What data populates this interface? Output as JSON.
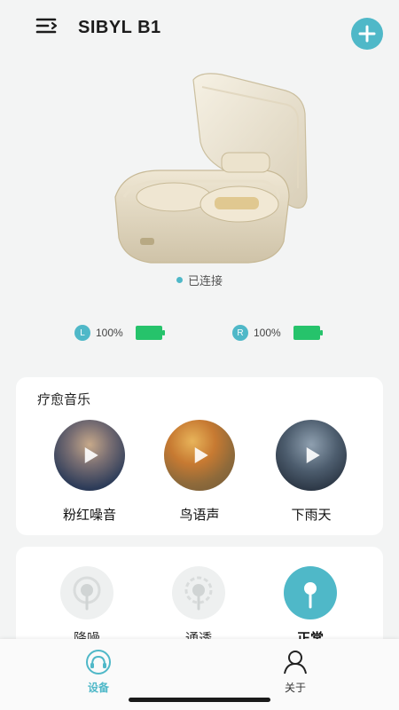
{
  "header": {
    "title": "SIBYL B1",
    "menu_icon": "menu-icon",
    "add_icon": "plus-icon",
    "accent": "#4fb8c8"
  },
  "device": {
    "status": "已连接",
    "left": {
      "side": "L",
      "battery": "100%",
      "level": 1.0
    },
    "right": {
      "side": "R",
      "battery": "100%",
      "level": 1.0
    },
    "battery_color": "#26c36b"
  },
  "music": {
    "title": "疗愈音乐",
    "items": [
      {
        "label": "粉红噪音"
      },
      {
        "label": "鸟语声"
      },
      {
        "label": "下雨天"
      }
    ]
  },
  "modes": {
    "items": [
      {
        "label": "降噪",
        "active": false
      },
      {
        "label": "通透",
        "active": false
      },
      {
        "label": "正常",
        "active": true
      }
    ]
  },
  "nav": {
    "items": [
      {
        "label": "设备",
        "icon": "headphones-icon",
        "active": true
      },
      {
        "label": "关于",
        "icon": "person-icon",
        "active": false
      }
    ]
  }
}
